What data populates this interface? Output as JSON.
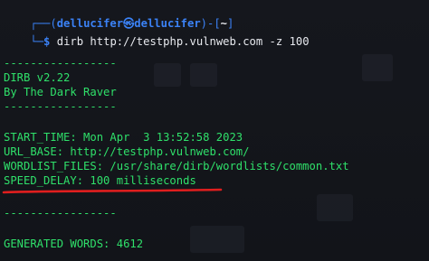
{
  "prompt": {
    "corner_top": "┌──(",
    "user_host": "dellucifer㉿dellucifer",
    "bracket_mid": ")-[",
    "path": "~",
    "bracket_end": "]",
    "corner_bottom": "└─",
    "dollar": "$ ",
    "command": "dirb",
    "url_arg": " http://testphp.vulnweb.com",
    "option": " -z",
    "option_value": " 100"
  },
  "output": {
    "separator_1": "-----------------",
    "banner_title": "DIRB v2.22",
    "banner_author": "By The Dark Raver",
    "separator_2": "-----------------",
    "start_time": "START_TIME: Mon Apr  3 13:52:58 2023",
    "url_base": "URL_BASE: http://testphp.vulnweb.com/",
    "wordlist_files": "WORDLIST_FILES: /usr/share/dirb/wordlists/common.txt",
    "speed_delay": "SPEED_DELAY: 100 milliseconds",
    "separator_3": "-----------------",
    "generated_words": "GENERATED WORDS: 4612"
  },
  "colors": {
    "background": "#15171c",
    "output_green": "#2fe06a",
    "prompt_blue": "#3b82f6",
    "command_white": "#e7e9ee",
    "annotation_red": "#e01e1e"
  }
}
